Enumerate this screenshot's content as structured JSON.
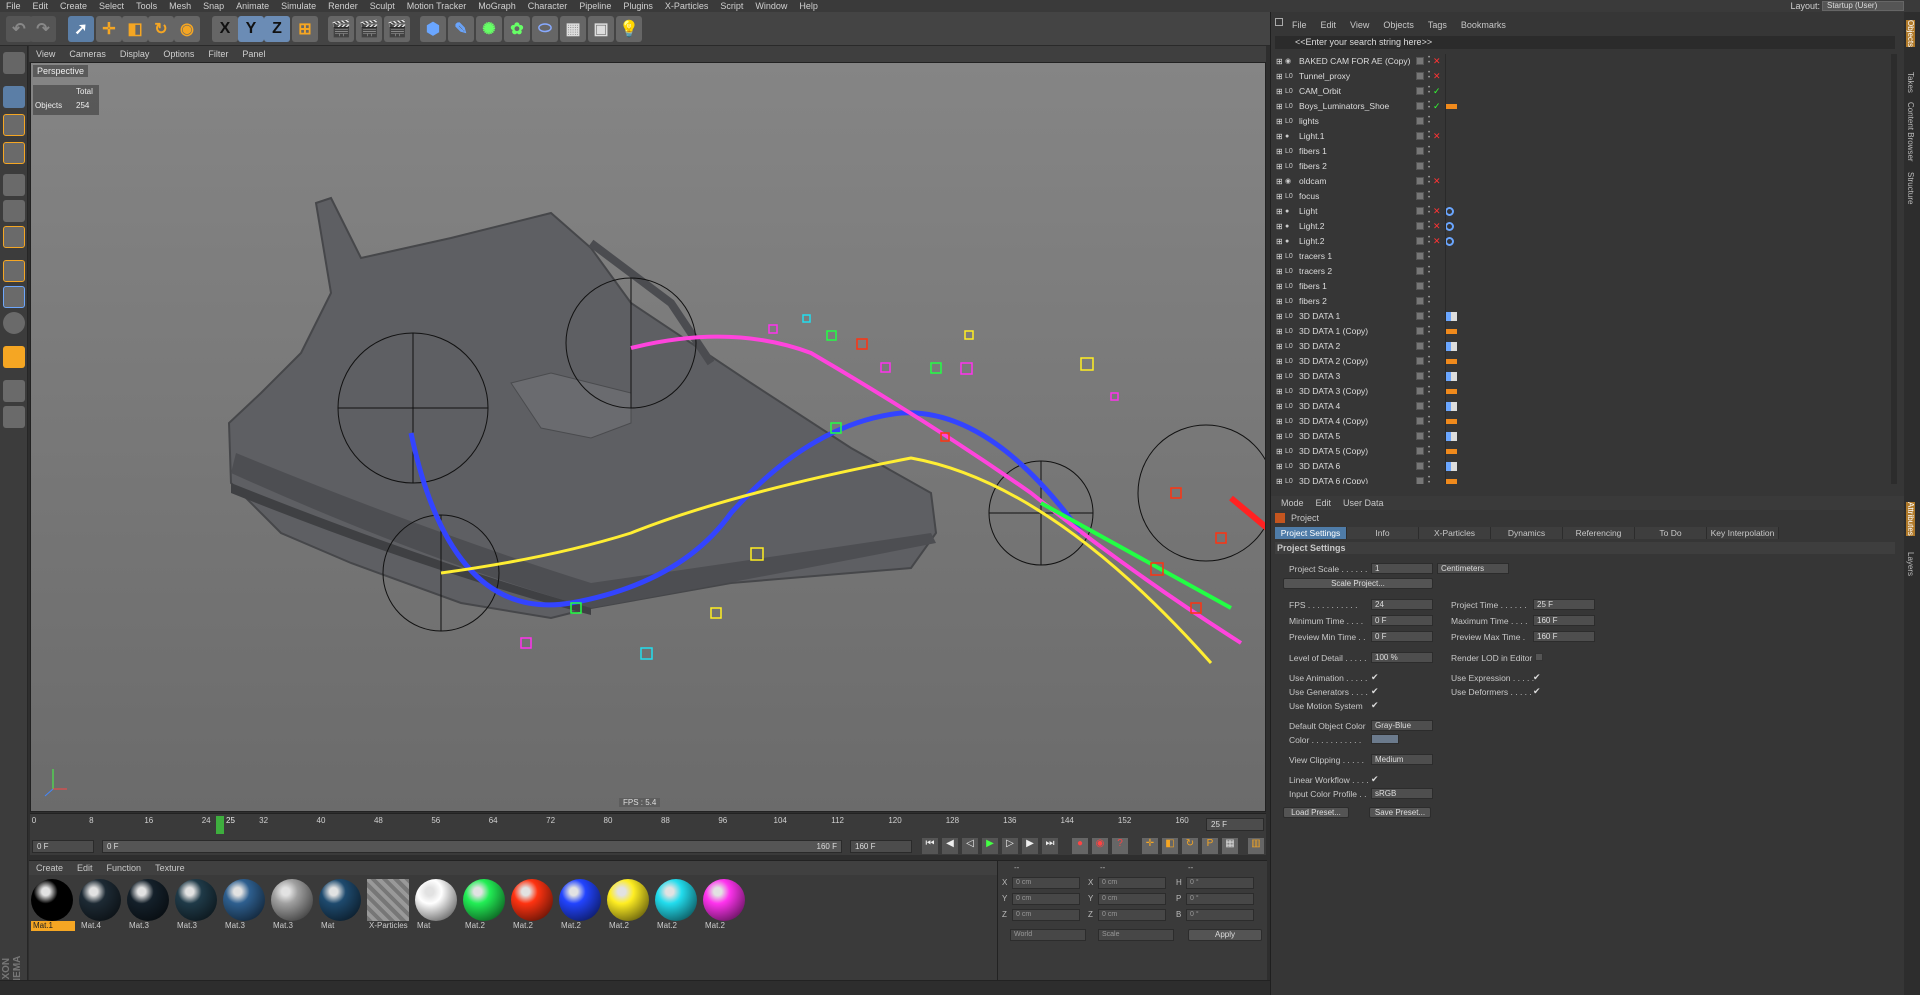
{
  "menubar": {
    "items": [
      "File",
      "Edit",
      "Create",
      "Select",
      "Tools",
      "Mesh",
      "Snap",
      "Animate",
      "Simulate",
      "Render",
      "Sculpt",
      "Motion Tracker",
      "MoGraph",
      "Character",
      "Pipeline",
      "Plugins",
      "X-Particles",
      "Script",
      "Window",
      "Help"
    ],
    "layout_label": "Layout:",
    "layout_value": "Startup (User)"
  },
  "toolbar": {
    "axis_x": "X",
    "axis_y": "Y",
    "axis_z": "Z"
  },
  "viewport": {
    "menu": [
      "View",
      "Cameras",
      "Display",
      "Options",
      "Filter",
      "Panel"
    ],
    "label": "Perspective",
    "hud_total_label": "Total",
    "hud_objects_label": "Objects",
    "hud_objects_value": "254",
    "fps": "FPS : 5.4"
  },
  "timeline": {
    "ticks": [
      "0",
      "8",
      "16",
      "24",
      "32",
      "40",
      "48",
      "56",
      "64",
      "72",
      "80",
      "88",
      "96",
      "104",
      "112",
      "120",
      "128",
      "136",
      "144",
      "152",
      "160"
    ],
    "current_marker": "25",
    "end_field": "25 F",
    "start_field": "0 F",
    "range_start": "0 F",
    "range_end_inner": "160 F",
    "range_end": "160 F"
  },
  "materials": {
    "menu": [
      "Create",
      "Edit",
      "Function",
      "Texture"
    ],
    "items": [
      {
        "label": "Mat.1",
        "color": "#000000",
        "selected": true
      },
      {
        "label": "Mat.4",
        "color": "#1d2a34"
      },
      {
        "label": "Mat.3",
        "color": "#14202a"
      },
      {
        "label": "Mat.3",
        "color": "#1f3a48"
      },
      {
        "label": "Mat.3",
        "color": "#2e5f8f"
      },
      {
        "label": "Mat.3",
        "color": "#a0a0a0"
      },
      {
        "label": "Mat",
        "color": "#1e4a6e"
      },
      {
        "label": "X-Particles",
        "color": "#888888"
      },
      {
        "label": "Mat",
        "color": "#ffffff"
      },
      {
        "label": "Mat.2",
        "color": "#22ee55"
      },
      {
        "label": "Mat.2",
        "color": "#ff3311"
      },
      {
        "label": "Mat.2",
        "color": "#2244ff"
      },
      {
        "label": "Mat.2",
        "color": "#ffee22"
      },
      {
        "label": "Mat.2",
        "color": "#22ddee"
      },
      {
        "label": "Mat.2",
        "color": "#ff33ee"
      }
    ]
  },
  "coords": {
    "header1": "--",
    "header2": "--",
    "header3": "--",
    "rows": [
      {
        "a": "X",
        "av": "0 cm",
        "b": "X",
        "bv": "0 cm",
        "c": "H",
        "cv": "0 °"
      },
      {
        "a": "Y",
        "av": "0 cm",
        "b": "Y",
        "bv": "0 cm",
        "c": "P",
        "cv": "0 °"
      },
      {
        "a": "Z",
        "av": "0 cm",
        "b": "Z",
        "bv": "0 cm",
        "c": "B",
        "cv": "0 °"
      }
    ],
    "world": "World",
    "scale": "Scale",
    "apply": "Apply"
  },
  "objects": {
    "menu": [
      "File",
      "Edit",
      "View",
      "Objects",
      "Tags",
      "Bookmarks"
    ],
    "search": "<<Enter your search string here>>",
    "rows": [
      {
        "name": "BAKED CAM FOR AE (Copy)",
        "icon": "cam",
        "st": "x",
        "tag": "none"
      },
      {
        "name": "Tunnel_proxy",
        "icon": "null",
        "st": "x",
        "tag": "none"
      },
      {
        "name": "CAM_Orbit",
        "icon": "null",
        "st": "check",
        "tag": "none"
      },
      {
        "name": "Boys_Luminators_Shoe",
        "icon": "null",
        "st": "check",
        "tag": "orange"
      },
      {
        "name": "lights",
        "icon": "null",
        "st": "dot",
        "tag": "none"
      },
      {
        "name": "Light.1",
        "icon": "light",
        "st": "x",
        "tag": "none"
      },
      {
        "name": "fibers 1",
        "icon": "null",
        "st": "dot",
        "tag": "none"
      },
      {
        "name": "fibers 2",
        "icon": "null",
        "st": "dot",
        "tag": "none"
      },
      {
        "name": "oldcam",
        "icon": "cam",
        "st": "x",
        "tag": "none"
      },
      {
        "name": "focus",
        "icon": "null",
        "st": "dot",
        "tag": "none"
      },
      {
        "name": "Light",
        "icon": "light",
        "st": "x",
        "tag": "blue"
      },
      {
        "name": "Light.2",
        "icon": "light",
        "st": "x",
        "tag": "blue"
      },
      {
        "name": "Light.2",
        "icon": "light",
        "st": "x",
        "tag": "blue"
      },
      {
        "name": "tracers 1",
        "icon": "null",
        "st": "dot",
        "tag": "none"
      },
      {
        "name": "tracers 2",
        "icon": "null",
        "st": "dot",
        "tag": "none"
      },
      {
        "name": "fibers 1",
        "icon": "null",
        "st": "dot",
        "tag": "none"
      },
      {
        "name": "fibers 2",
        "icon": "null",
        "st": "dot",
        "tag": "none"
      },
      {
        "name": "3D DATA 1",
        "icon": "null",
        "st": "dot",
        "tag": "multi"
      },
      {
        "name": "3D DATA 1 (Copy)",
        "icon": "null",
        "st": "dot",
        "tag": "orange"
      },
      {
        "name": "3D DATA 2",
        "icon": "null",
        "st": "dot",
        "tag": "multi"
      },
      {
        "name": "3D DATA 2 (Copy)",
        "icon": "null",
        "st": "dot",
        "tag": "orange"
      },
      {
        "name": "3D DATA 3",
        "icon": "null",
        "st": "dot",
        "tag": "multi"
      },
      {
        "name": "3D DATA 3 (Copy)",
        "icon": "null",
        "st": "dot",
        "tag": "orange"
      },
      {
        "name": "3D DATA 4",
        "icon": "null",
        "st": "dot",
        "tag": "multi"
      },
      {
        "name": "3D DATA 4 (Copy)",
        "icon": "null",
        "st": "dot",
        "tag": "orange"
      },
      {
        "name": "3D DATA 5",
        "icon": "null",
        "st": "dot",
        "tag": "multi"
      },
      {
        "name": "3D DATA 5 (Copy)",
        "icon": "null",
        "st": "dot",
        "tag": "orange"
      },
      {
        "name": "3D DATA 6",
        "icon": "null",
        "st": "dot",
        "tag": "multi"
      },
      {
        "name": "3D DATA 6 (Copy)",
        "icon": "null",
        "st": "dot",
        "tag": "orange"
      }
    ]
  },
  "attributes": {
    "menu": [
      "Mode",
      "Edit",
      "User Data"
    ],
    "title": "Project",
    "tabs": [
      "Project Settings",
      "Info",
      "X-Particles",
      "Dynamics",
      "Referencing",
      "To Do",
      "Key Interpolation"
    ],
    "section": "Project Settings",
    "project_scale_label": "Project Scale . . . . . .",
    "project_scale_value": "1",
    "project_scale_unit": "Centimeters",
    "scale_project_button": "Scale Project...",
    "fps_label": "FPS . . . . . . . . . . .",
    "fps_value": "24",
    "project_time_label": "Project Time . . . . . .",
    "project_time_value": "25 F",
    "min_time_label": "Minimum Time . . . .",
    "min_time_value": "0 F",
    "max_time_label": "Maximum Time . . . .",
    "max_time_value": "160 F",
    "preview_min_label": "Preview Min Time . .",
    "preview_min_value": "0 F",
    "preview_max_label": "Preview Max Time .",
    "preview_max_value": "160 F",
    "lod_label": "Level of Detail . . . . .",
    "lod_value": "100 %",
    "render_lod_label": "Render LOD in Editor",
    "use_animation_label": "Use Animation . . . . .",
    "use_expression_label": "Use Expression . . . . .",
    "use_generators_label": "Use Generators . . . .",
    "use_deformers_label": "Use Deformers . . . . .",
    "use_motion_label": "Use Motion System",
    "default_color_label": "Default Object Color",
    "default_color_value": "Gray-Blue",
    "color_label": "Color . . . . . . . . . . .",
    "view_clipping_label": "View Clipping . . . . .",
    "view_clipping_value": "Medium",
    "linear_workflow_label": "Linear Workflow . . . .",
    "input_color_label": "Input Color Profile . .",
    "input_color_value": "sRGB",
    "load_preset": "Load Preset...",
    "save_preset": "Save Preset...",
    "check": "✔"
  },
  "sidetabs": [
    "Objects",
    "Takes",
    "Content Browser",
    "Structure",
    "Attributes",
    "Layers"
  ],
  "brand": "MAXON CINEMA 4D"
}
